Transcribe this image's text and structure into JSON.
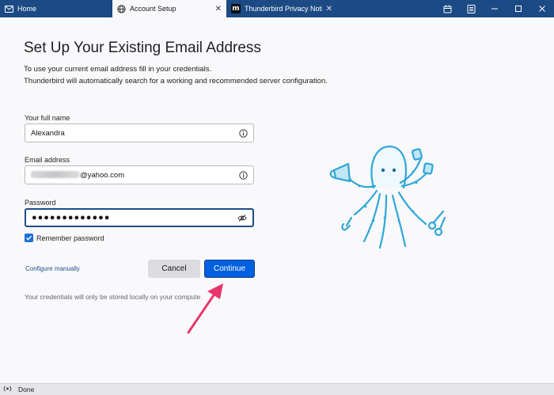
{
  "tabs": [
    {
      "label": "Home",
      "icon": "mail-icon"
    },
    {
      "label": "Account Setup",
      "icon": "globe-icon"
    },
    {
      "label": "Thunderbird Privacy Notice",
      "icon": "mozilla-m-icon"
    }
  ],
  "window_controls": [
    "calendar-icon",
    "tasks-icon",
    "minimize-icon",
    "maximize-icon",
    "close-icon"
  ],
  "page": {
    "title": "Set Up Your Existing Email Address",
    "intro_line1": "To use your current email address fill in your credentials.",
    "intro_line2": "Thunderbird will automatically search for a working and recommended server configuration."
  },
  "form": {
    "name_label": "Your full name",
    "name_value": "Alexandra",
    "email_label": "Email address",
    "email_value_suffix": "@yahoo.com",
    "password_label": "Password",
    "password_value": "●●●●●●●●●●●●●",
    "remember_label": "Remember password",
    "remember_checked": true
  },
  "actions": {
    "configure_manually": "Configure manually",
    "cancel": "Cancel",
    "continue": "Continue"
  },
  "footnote": "Your credentials will only be stored locally on your compute",
  "status": {
    "text": "Done"
  },
  "colors": {
    "titlebar": "#1c4a84",
    "primary_button": "#0060df",
    "mascot": "#2fa6d8",
    "arrow": "#e8376a"
  }
}
